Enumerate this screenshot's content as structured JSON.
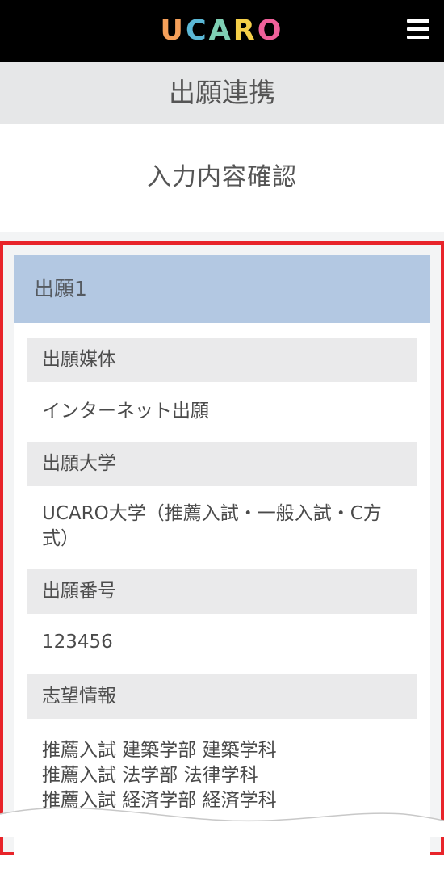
{
  "header": {
    "logo": {
      "letters": [
        "U",
        "C",
        "A",
        "R",
        "O"
      ],
      "colors": [
        "#f5a05a",
        "#5bb8d6",
        "#7fd0b4",
        "#f5cf49",
        "#f0609a"
      ]
    },
    "menu_icon": "hamburger-menu-icon"
  },
  "page_title": "出願連携",
  "step_title": "入力内容確認",
  "application": {
    "heading": "出願1",
    "fields": [
      {
        "label": "出願媒体",
        "value": "インターネット出願"
      },
      {
        "label": "出願大学",
        "value": "UCARO大学（推薦入試・一般入試・C方式）"
      },
      {
        "label": "出願番号",
        "value": "123456"
      },
      {
        "label": "志望情報",
        "value": "推薦入試 建築学部 建築学科\n推薦入試 法学部 法律学科\n推薦入試 経済学部 経済学科"
      }
    ]
  },
  "colors": {
    "header_bg": "#000000",
    "title_bar_bg": "#e6e7e8",
    "highlight_border": "#e8242a",
    "app_head_bg": "#b3c8e2",
    "label_bg": "#eaeaeb"
  }
}
